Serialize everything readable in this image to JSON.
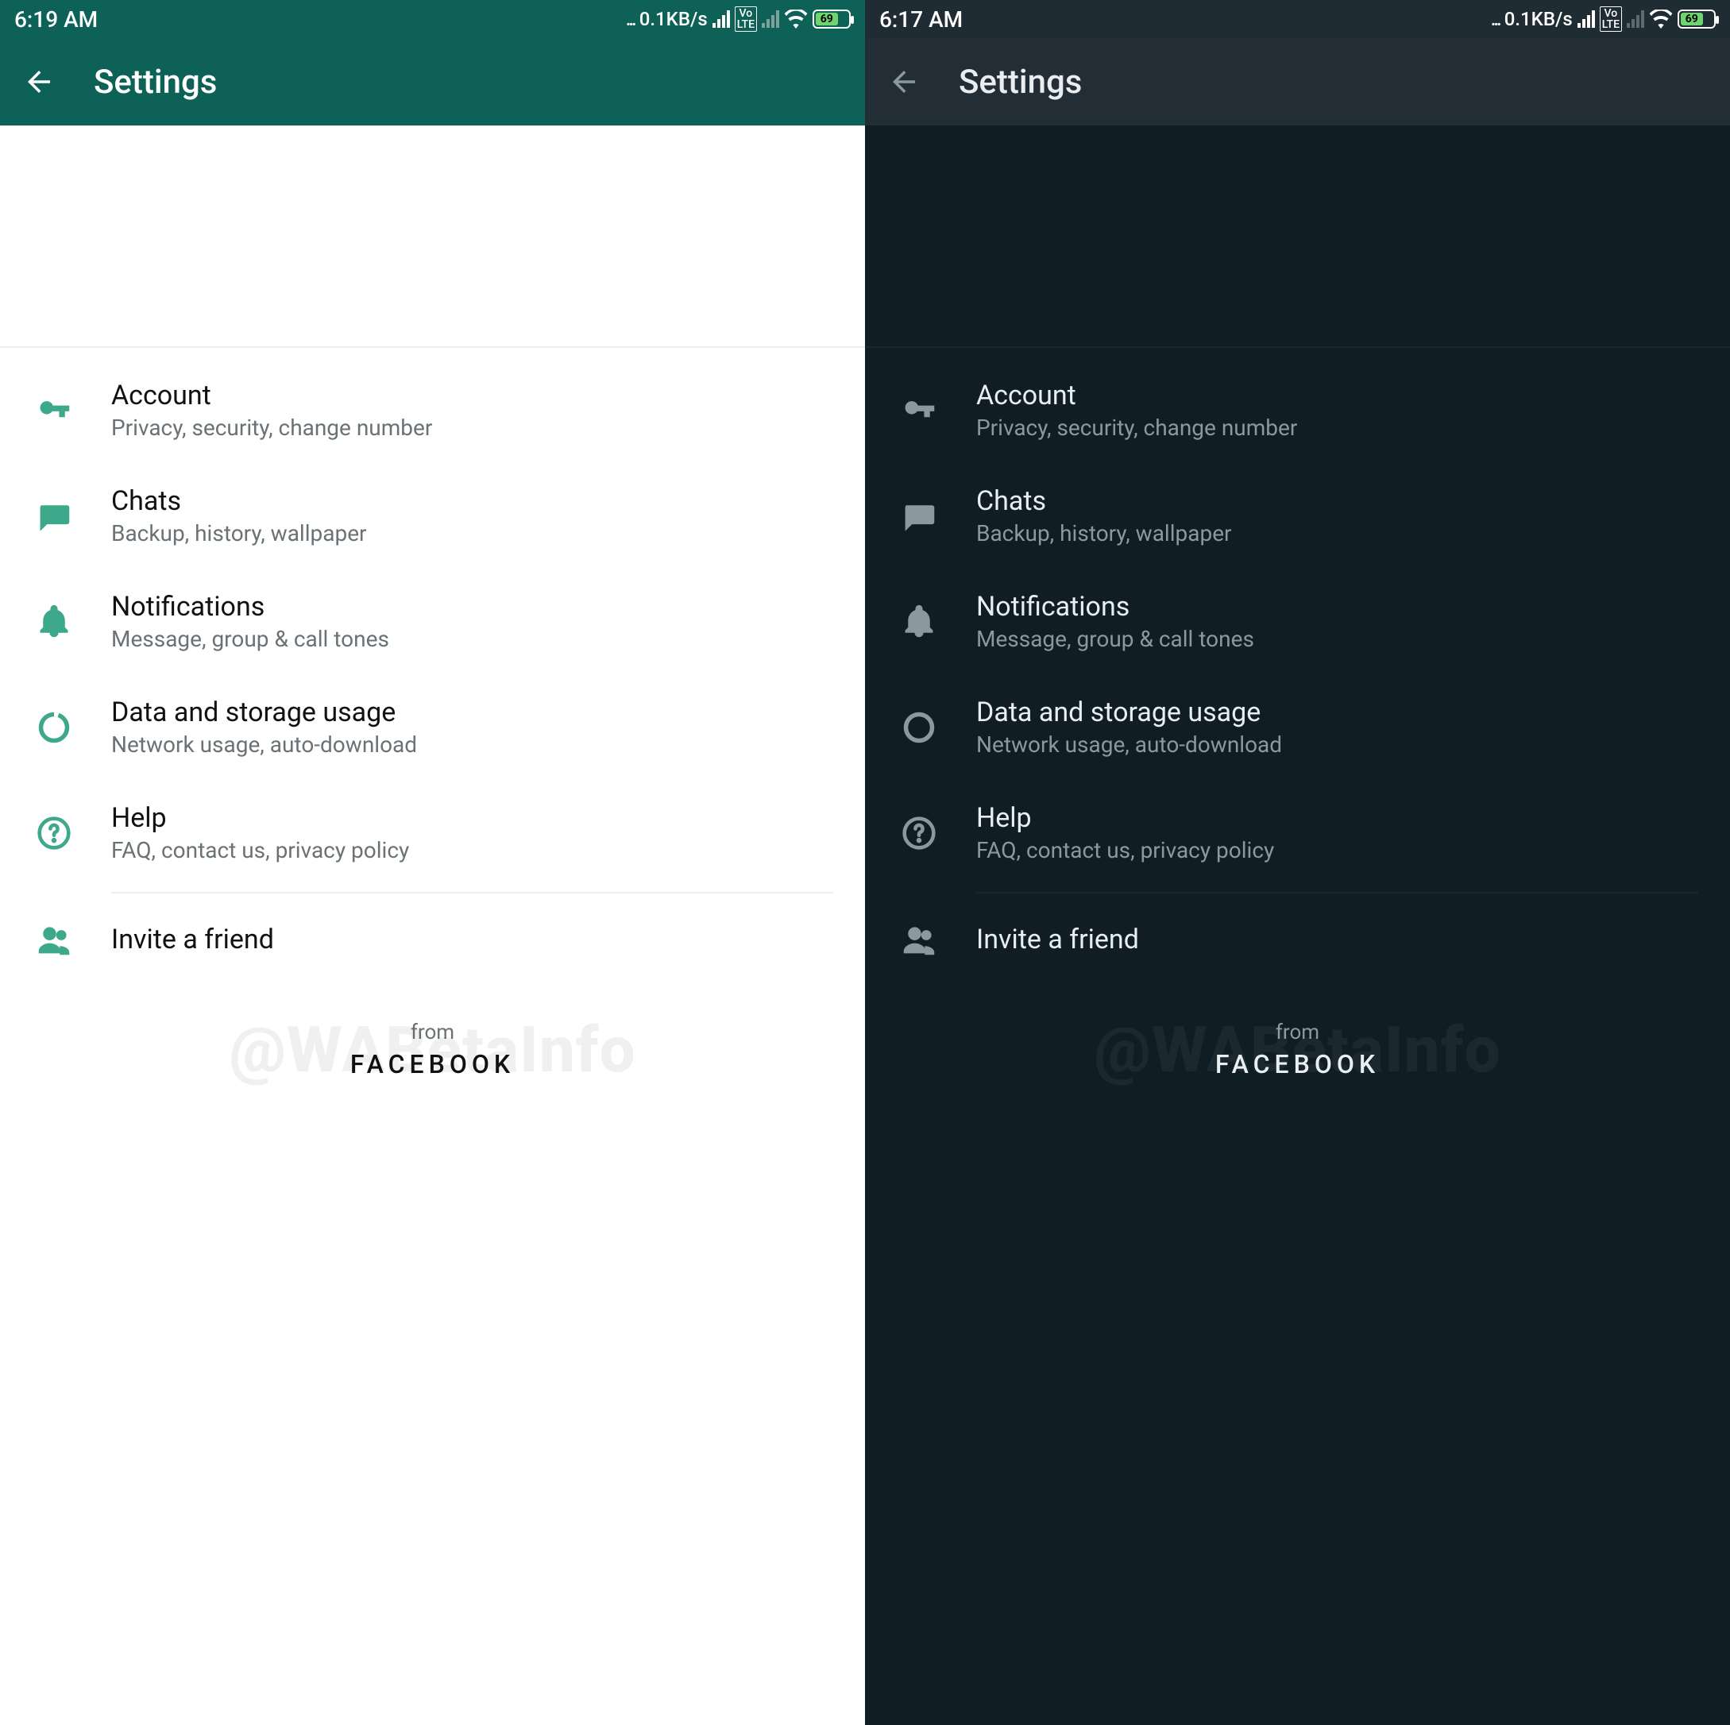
{
  "watermark": "@WABetaInfo",
  "light": {
    "status": {
      "time": "6:19 AM",
      "net": "0.1KB/s",
      "volte": "Vo\nLTE",
      "battery_pct": 69
    },
    "appbar": {
      "title": "Settings"
    },
    "items": [
      {
        "title": "Account",
        "subtitle": "Privacy, security, change number",
        "icon": "key"
      },
      {
        "title": "Chats",
        "subtitle": "Backup, history, wallpaper",
        "icon": "chat"
      },
      {
        "title": "Notifications",
        "subtitle": "Message, group & call tones",
        "icon": "bell"
      },
      {
        "title": "Data and storage usage",
        "subtitle": "Network usage, auto-download",
        "icon": "data"
      },
      {
        "title": "Help",
        "subtitle": "FAQ, contact us, privacy policy",
        "icon": "help"
      }
    ],
    "invite": {
      "title": "Invite a friend"
    },
    "footer": {
      "from": "from",
      "brand": "FACEBOOK"
    }
  },
  "dark": {
    "status": {
      "time": "6:17 AM",
      "net": "0.1KB/s",
      "volte": "Vo\nLTE",
      "battery_pct": 69
    },
    "appbar": {
      "title": "Settings"
    },
    "items": [
      {
        "title": "Account",
        "subtitle": "Privacy, security, change number",
        "icon": "key"
      },
      {
        "title": "Chats",
        "subtitle": "Backup, history, wallpaper",
        "icon": "chat"
      },
      {
        "title": "Notifications",
        "subtitle": "Message, group & call tones",
        "icon": "bell"
      },
      {
        "title": "Data and storage usage",
        "subtitle": "Network usage, auto-download",
        "icon": "data"
      },
      {
        "title": "Help",
        "subtitle": "FAQ, contact us, privacy policy",
        "icon": "help"
      }
    ],
    "invite": {
      "title": "Invite a friend"
    },
    "footer": {
      "from": "from",
      "brand": "FACEBOOK"
    }
  }
}
